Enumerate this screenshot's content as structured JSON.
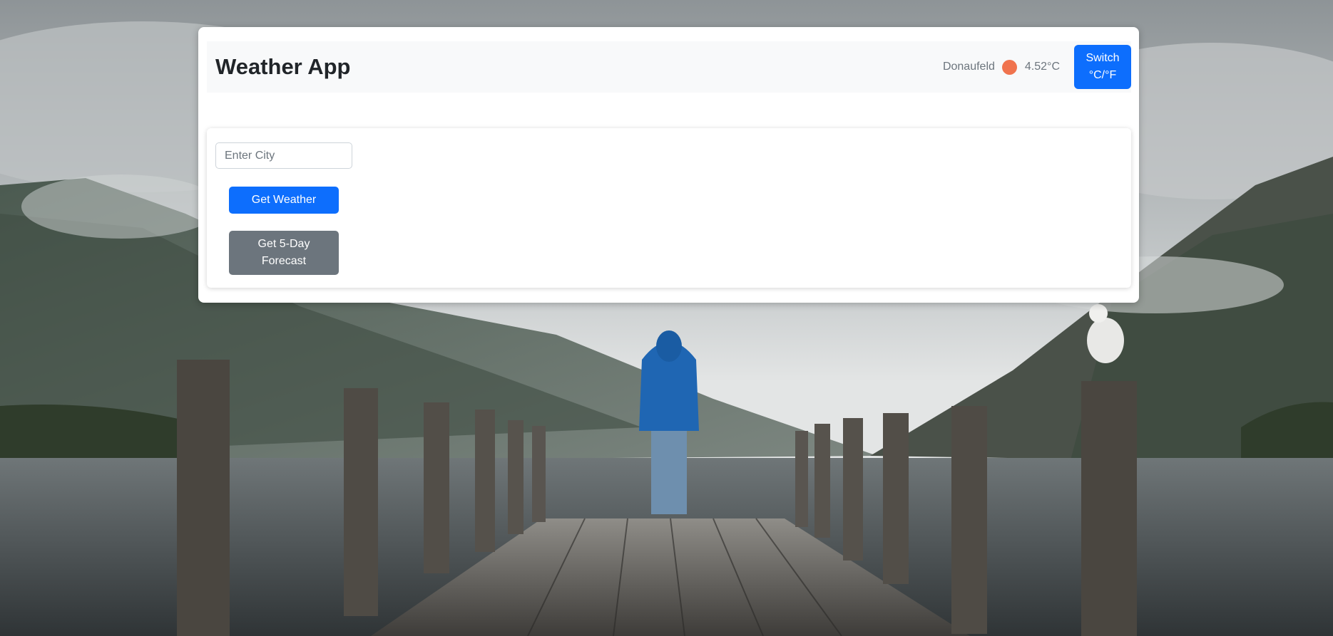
{
  "header": {
    "title": "Weather App",
    "location": "Donaufeld",
    "temperature": "4.52°C",
    "switch_label": "Switch °C/°F",
    "status_color": "#f0734e"
  },
  "form": {
    "city_placeholder": "Enter City",
    "city_value": "",
    "get_weather_label": "Get Weather",
    "get_forecast_label": "Get 5-Day Forecast"
  },
  "theme": {
    "primary": "#0d6efd",
    "secondary": "#6c757d",
    "header_bg": "#f8f9fa"
  }
}
